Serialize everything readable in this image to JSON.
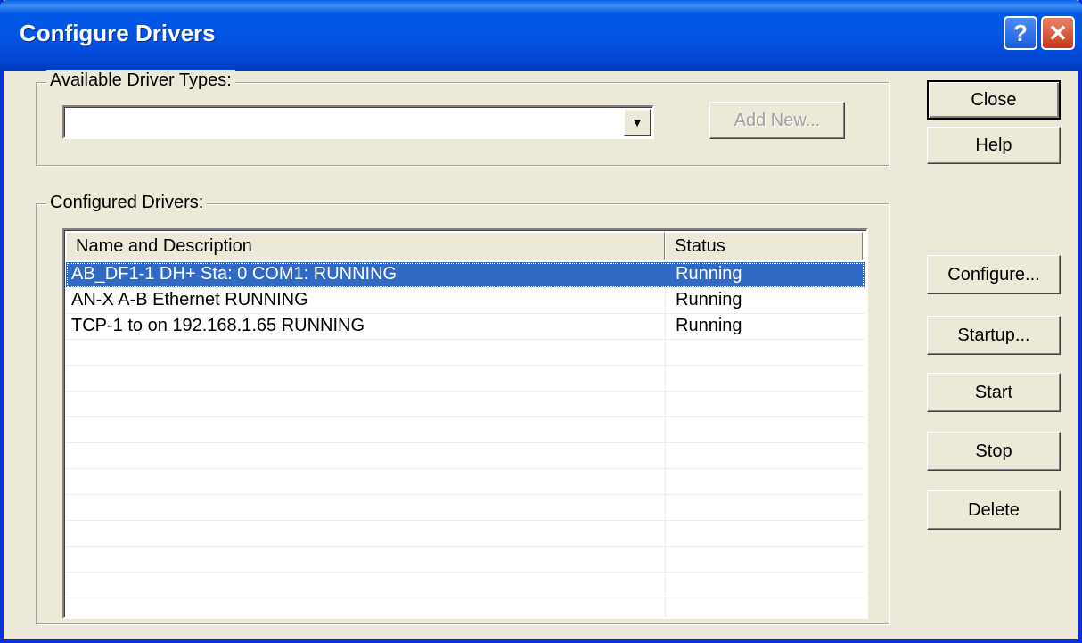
{
  "window": {
    "title": "Configure Drivers",
    "help_icon": "?",
    "close_icon": "✕"
  },
  "available": {
    "group_label": "Available Driver Types:",
    "combo_value": "",
    "add_new_label": "Add New..."
  },
  "configured": {
    "group_label": "Configured Drivers:",
    "columns": [
      "Name and Description",
      "Status"
    ],
    "rows": [
      {
        "name": "AB_DF1-1 DH+ Sta: 0 COM1: RUNNING",
        "status": "Running",
        "selected": true
      },
      {
        "name": "AN-X  A-B Ethernet  RUNNING",
        "status": "Running",
        "selected": false
      },
      {
        "name": "TCP-1 to  on 192.168.1.65 RUNNING",
        "status": "Running",
        "selected": false
      }
    ],
    "empty_rows": 10
  },
  "buttons": {
    "close": "Close",
    "help": "Help",
    "configure": "Configure...",
    "startup": "Startup...",
    "start": "Start",
    "stop": "Stop",
    "delete": "Delete"
  },
  "colors": {
    "selection": "#316ac5",
    "titlebar": "#0454e2",
    "face": "#ece9d8"
  }
}
